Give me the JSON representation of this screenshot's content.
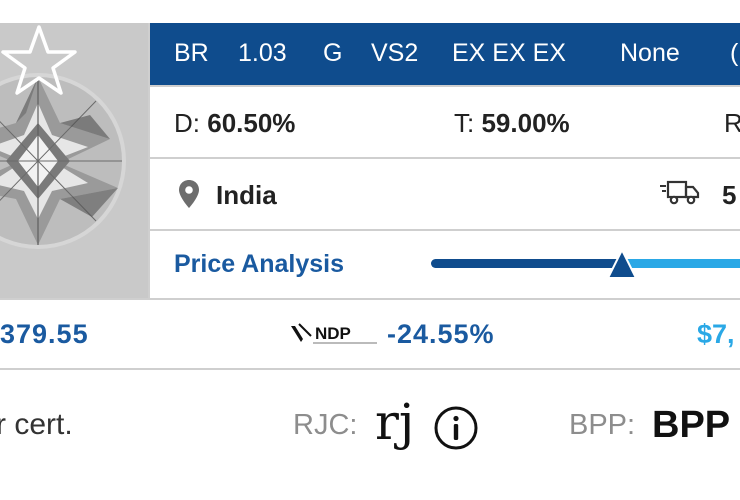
{
  "specs": {
    "shape": "BR",
    "carat": "1.03",
    "color": "G",
    "clarity": "VS2",
    "cut_polish_sym": "EX EX EX",
    "fluorescence": "None",
    "overflow": "("
  },
  "measurements": {
    "depth_label": "D:",
    "depth_value": "60.50%",
    "table_label": "T:",
    "table_value": "59.00%",
    "overflow": "R"
  },
  "location": {
    "country": "India",
    "shipping_days": "5"
  },
  "price_analysis": {
    "title": "Price Analysis",
    "position_fraction": 0.56
  },
  "summary": {
    "left_amount": "379.55",
    "ndp_logo_text": "NDP",
    "ndp_percent": "-24.55%",
    "right_amount": "$7,"
  },
  "certification": {
    "cert_text": "r cert.",
    "rjc_label": "RJC:",
    "rjc_logo": "rj",
    "bpp_label": "BPP:",
    "bpp_value": "BPP"
  },
  "colors": {
    "brand_blue": "#0f4c8d",
    "accent_light_blue": "#2aa8e6",
    "divider": "#cfcfcf"
  },
  "icons": [
    "diamond-photo",
    "favorite-star-icon",
    "location-pin-icon",
    "truck-icon",
    "price-marker-icon",
    "ndp-logo",
    "rjc-logo",
    "info-icon"
  ]
}
